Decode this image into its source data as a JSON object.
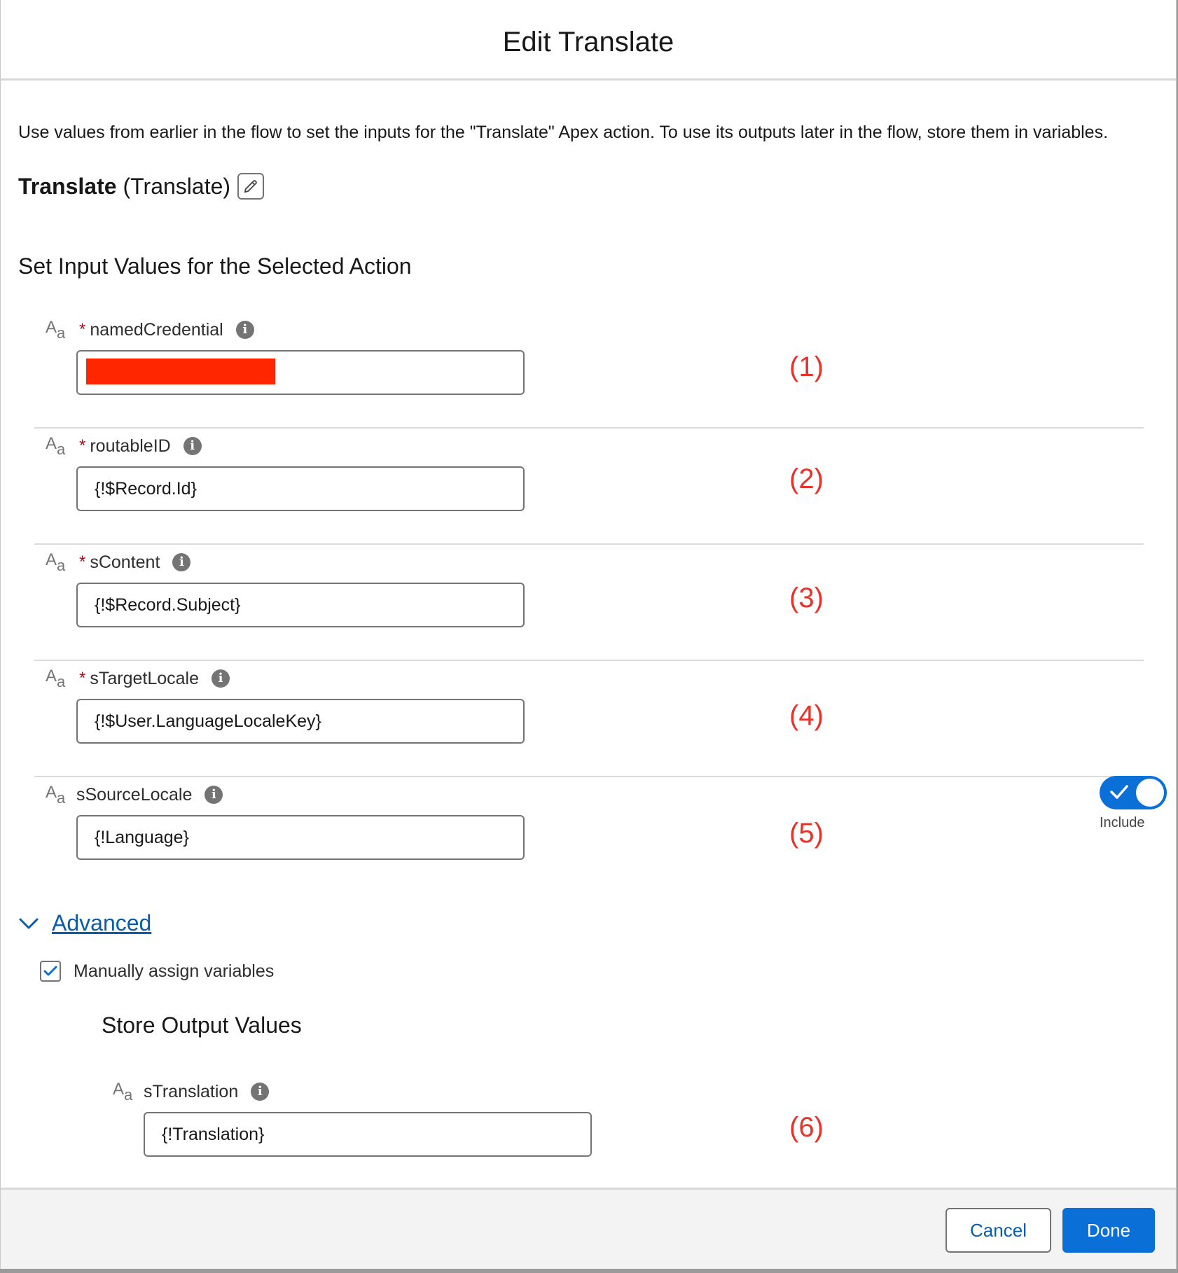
{
  "modal": {
    "title": "Edit Translate"
  },
  "intro": {
    "description": "Use values from earlier in the flow to set the inputs for the \"Translate\" Apex action. To use its outputs later in the flow, store them in variables.",
    "action_label": "Translate",
    "action_api_name": "(Translate)"
  },
  "inputs_section": {
    "title": "Set Input Values for the Selected Action"
  },
  "params": [
    {
      "type_icon": "text-type-icon",
      "label": "namedCredential",
      "required": "*",
      "value": "",
      "redacted": true,
      "annotation": "(1)"
    },
    {
      "type_icon": "text-type-icon",
      "label": "routableID",
      "required": "*",
      "value": "{!$Record.Id}",
      "annotation": "(2)"
    },
    {
      "type_icon": "text-type-icon",
      "label": "sContent",
      "required": "*",
      "value": "{!$Record.Subject}",
      "annotation": "(3)"
    },
    {
      "type_icon": "text-type-icon",
      "label": "sTargetLocale",
      "required": "*",
      "value": "{!$User.LanguageLocaleKey}",
      "annotation": "(4)"
    },
    {
      "type_icon": "text-type-icon",
      "label": "sSourceLocale",
      "required": "",
      "value": "{!Language}",
      "annotation": "(5)",
      "include_toggle": {
        "label": "Include",
        "on": true
      }
    }
  ],
  "advanced": {
    "label": "Advanced",
    "expanded": true,
    "manual_assign_label": "Manually assign variables",
    "manual_assign_checked": true
  },
  "outputs_section": {
    "title": "Store Output Values",
    "params": [
      {
        "type_icon": "text-type-icon",
        "label": "sTranslation",
        "value": "{!Translation}",
        "annotation": "(6)"
      }
    ]
  },
  "footer": {
    "cancel_label": "Cancel",
    "done_label": "Done"
  },
  "colors": {
    "brand": "#0b6fd8",
    "annotation": "#e8322b",
    "redaction": "#ff2600"
  }
}
